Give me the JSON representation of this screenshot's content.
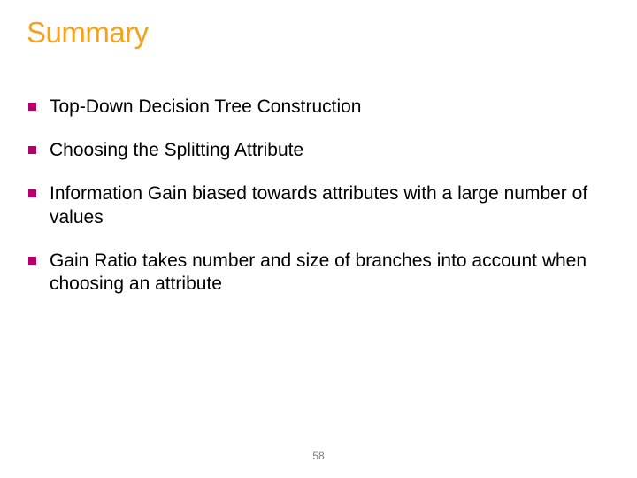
{
  "title": "Summary",
  "bullets": [
    "Top-Down Decision Tree Construction",
    "Choosing the Splitting Attribute",
    "Information Gain biased towards attributes with a large number of values",
    " Gain Ratio takes number and size of branches into account when choosing an attribute"
  ],
  "page_number": "58"
}
